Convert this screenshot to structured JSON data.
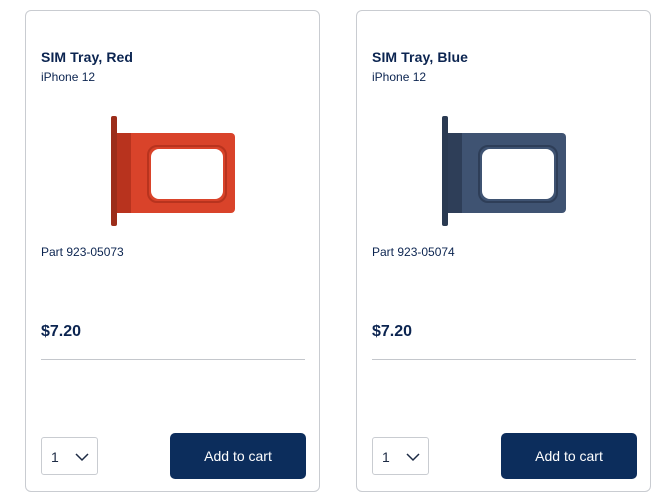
{
  "products": [
    {
      "title": "SIM Tray, Red",
      "model": "iPhone 12",
      "part": "Part 923-05073",
      "price": "$7.20",
      "quantity": "1",
      "button_label": "Add to cart",
      "image_color": "#d9432a",
      "image_shade": "#b8331e",
      "image_icon": "sim-tray-red"
    },
    {
      "title": "SIM Tray, Blue",
      "model": "iPhone 12",
      "part": "Part 923-05074",
      "price": "$7.20",
      "quantity": "1",
      "button_label": "Add to cart",
      "image_color": "#3f5372",
      "image_shade": "#2e3e58",
      "image_icon": "sim-tray-blue"
    }
  ],
  "colors": {
    "text": "#0b2450",
    "button": "#0c2d5c",
    "border": "#c9ccd1"
  }
}
